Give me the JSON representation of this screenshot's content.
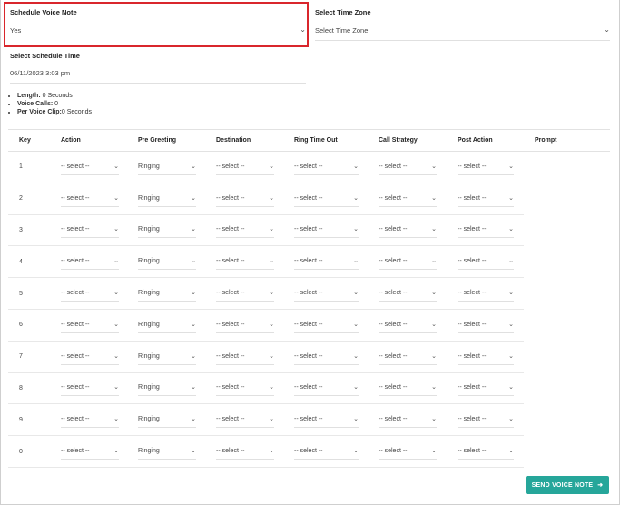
{
  "schedule_voice_note": {
    "label": "Schedule Voice Note",
    "value": "Yes"
  },
  "time_zone": {
    "label": "Select Time Zone",
    "placeholder": "Select Time Zone"
  },
  "schedule_time": {
    "label": "Select Schedule Time",
    "value": "06/11/2023 3:03 pm"
  },
  "info": [
    {
      "key": "Length:",
      "value": " 0 Seconds"
    },
    {
      "key": "Voice Calls:",
      "value": " 0"
    },
    {
      "key": "Per Voice Clip:",
      "value": "0 Seconds"
    }
  ],
  "table": {
    "headers": [
      "Key",
      "Action",
      "Pre Greeting",
      "Destination",
      "Ring Time Out",
      "Call Strategy",
      "Post Action",
      "Prompt"
    ],
    "rows": [
      {
        "key": "1",
        "action": "-- select --",
        "pre_greeting": "Ringing",
        "destination": "-- select --",
        "ring_time_out": "-- select --",
        "call_strategy": "-- select --",
        "post_action": "-- select --"
      },
      {
        "key": "2",
        "action": "-- select --",
        "pre_greeting": "Ringing",
        "destination": "-- select --",
        "ring_time_out": "-- select --",
        "call_strategy": "-- select --",
        "post_action": "-- select --"
      },
      {
        "key": "3",
        "action": "-- select --",
        "pre_greeting": "Ringing",
        "destination": "-- select --",
        "ring_time_out": "-- select --",
        "call_strategy": "-- select --",
        "post_action": "-- select --"
      },
      {
        "key": "4",
        "action": "-- select --",
        "pre_greeting": "Ringing",
        "destination": "-- select --",
        "ring_time_out": "-- select --",
        "call_strategy": "-- select --",
        "post_action": "-- select --"
      },
      {
        "key": "5",
        "action": "-- select --",
        "pre_greeting": "Ringing",
        "destination": "-- select --",
        "ring_time_out": "-- select --",
        "call_strategy": "-- select --",
        "post_action": "-- select --"
      },
      {
        "key": "6",
        "action": "-- select --",
        "pre_greeting": "Ringing",
        "destination": "-- select --",
        "ring_time_out": "-- select --",
        "call_strategy": "-- select --",
        "post_action": "-- select --"
      },
      {
        "key": "7",
        "action": "-- select --",
        "pre_greeting": "Ringing",
        "destination": "-- select --",
        "ring_time_out": "-- select --",
        "call_strategy": "-- select --",
        "post_action": "-- select --"
      },
      {
        "key": "8",
        "action": "-- select --",
        "pre_greeting": "Ringing",
        "destination": "-- select --",
        "ring_time_out": "-- select --",
        "call_strategy": "-- select --",
        "post_action": "-- select --"
      },
      {
        "key": "9",
        "action": "-- select --",
        "pre_greeting": "Ringing",
        "destination": "-- select --",
        "ring_time_out": "-- select --",
        "call_strategy": "-- select --",
        "post_action": "-- select --"
      },
      {
        "key": "0",
        "action": "-- select --",
        "pre_greeting": "Ringing",
        "destination": "-- select --",
        "ring_time_out": "-- select --",
        "call_strategy": "-- select --",
        "post_action": "-- select --"
      }
    ]
  },
  "send_button": {
    "label": "SEND VOICE NOTE",
    "icon": "arrow-right-icon",
    "color": "#26a69a"
  },
  "colors": {
    "highlight_border": "#d9262c",
    "accent": "#26a69a"
  }
}
